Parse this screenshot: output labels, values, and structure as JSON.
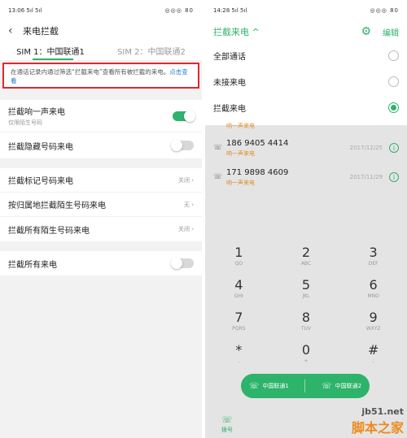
{
  "left": {
    "status": {
      "time": "13:06",
      "signal": "5ıl 5ıl",
      "icons": "◎◎◎ 80"
    },
    "header": {
      "back_glyph": "‹",
      "title": "来电拦截"
    },
    "sim_tabs": [
      {
        "label": "SIM 1：中国联通1"
      },
      {
        "label": "SIM 2：中国联通2"
      }
    ],
    "notice": {
      "text": "在通话记录内通过筛选“拦截来电”查看所有被拦截的来电。",
      "link": "点击查看"
    },
    "groups": [
      [
        {
          "label": "拦截响一声来电",
          "sub": "仅限陌生号码",
          "toggle": "on"
        },
        {
          "label": "拦截隐藏号码来电",
          "toggle": "off"
        }
      ],
      [
        {
          "label": "拦截标记号码来电",
          "value": "关闭 ›"
        },
        {
          "label": "按归属地拦截陌生号码来电",
          "value": "无 ›"
        },
        {
          "label": "拦截所有陌生号码来电",
          "value": "关闭 ›"
        }
      ],
      [
        {
          "label": "拦截所有来电",
          "toggle": "off"
        }
      ]
    ]
  },
  "right": {
    "status": {
      "time": "14:28",
      "signal": "5ıl 5ıl",
      "icons": "◎◎◎ 80"
    },
    "header": {
      "title": "拦截来电 ^",
      "gear_glyph": "⚙",
      "edit": "编辑"
    },
    "filters": [
      {
        "label": "全部通话",
        "checked": false
      },
      {
        "label": "未接来电",
        "checked": false
      },
      {
        "label": "拦截来电",
        "checked": true
      }
    ],
    "truncated_tag": "响一声来电",
    "calls": [
      {
        "number": "186 9405 4414",
        "tag": "响一声来电",
        "date": "2017/12/25"
      },
      {
        "number": "171 9898 4609",
        "tag": "响一声来电",
        "date": "2017/11/29"
      }
    ],
    "keypad": [
      [
        {
          "d": "1",
          "l": "QO"
        },
        {
          "d": "2",
          "l": "ABC"
        },
        {
          "d": "3",
          "l": "DEF"
        }
      ],
      [
        {
          "d": "4",
          "l": "GHI"
        },
        {
          "d": "5",
          "l": "JKL"
        },
        {
          "d": "6",
          "l": "MNO"
        }
      ],
      [
        {
          "d": "7",
          "l": "PQRS"
        },
        {
          "d": "8",
          "l": "TUV"
        },
        {
          "d": "9",
          "l": "WXYZ"
        }
      ],
      [
        {
          "d": "*",
          "l": ","
        },
        {
          "d": "0",
          "l": "+"
        },
        {
          "d": "#",
          "l": ";"
        }
      ]
    ],
    "dial": {
      "sim1": "中国联通1",
      "sim2": "中国联通2"
    },
    "bottom_tab": {
      "label": "拨号"
    }
  },
  "watermark": {
    "url": "jb51.net",
    "name": "脚本之家"
  },
  "colors": {
    "accent": "#2db36a",
    "warning": "#e38a2a",
    "highlight_border": "#e3262f",
    "link": "#1f7bd4"
  }
}
